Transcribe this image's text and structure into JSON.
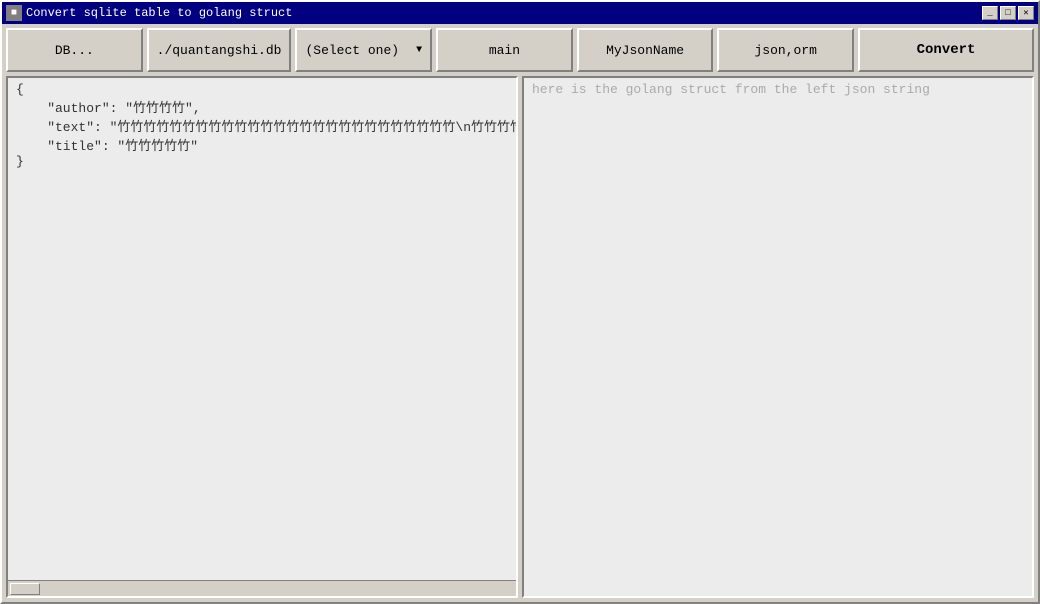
{
  "window": {
    "title": "Convert sqlite table to golang struct",
    "title_icon": "■",
    "controls": {
      "minimize": "_",
      "maximize": "□",
      "close": "✕"
    }
  },
  "toolbar": {
    "db_button_label": "DB...",
    "db_path_label": "./quantangshi.db",
    "select_label": "(Select one)",
    "table_label": "main",
    "json_name_label": "MyJsonName",
    "tags_label": "json,orm",
    "convert_label": "Convert"
  },
  "left_panel": {
    "content": "{\n    \"author\": \"竹竹竹竹\",\n    \"text\": \"竹竹竹竹竹竹竹竹竹竹竹竹竹竹竹竹竹竹竹竹竹竹竹竹竹竹\\n竹竹竹竹竹竹竹竹竹竹竹竹竹竹竹竹竹竹竹竹竹竹竹竹竹竹",
    "content_line3": "    \"title\": \"竹竹竹竹竹\"\n}"
  },
  "right_panel": {
    "placeholder": "here is the golang struct from the left json string"
  }
}
